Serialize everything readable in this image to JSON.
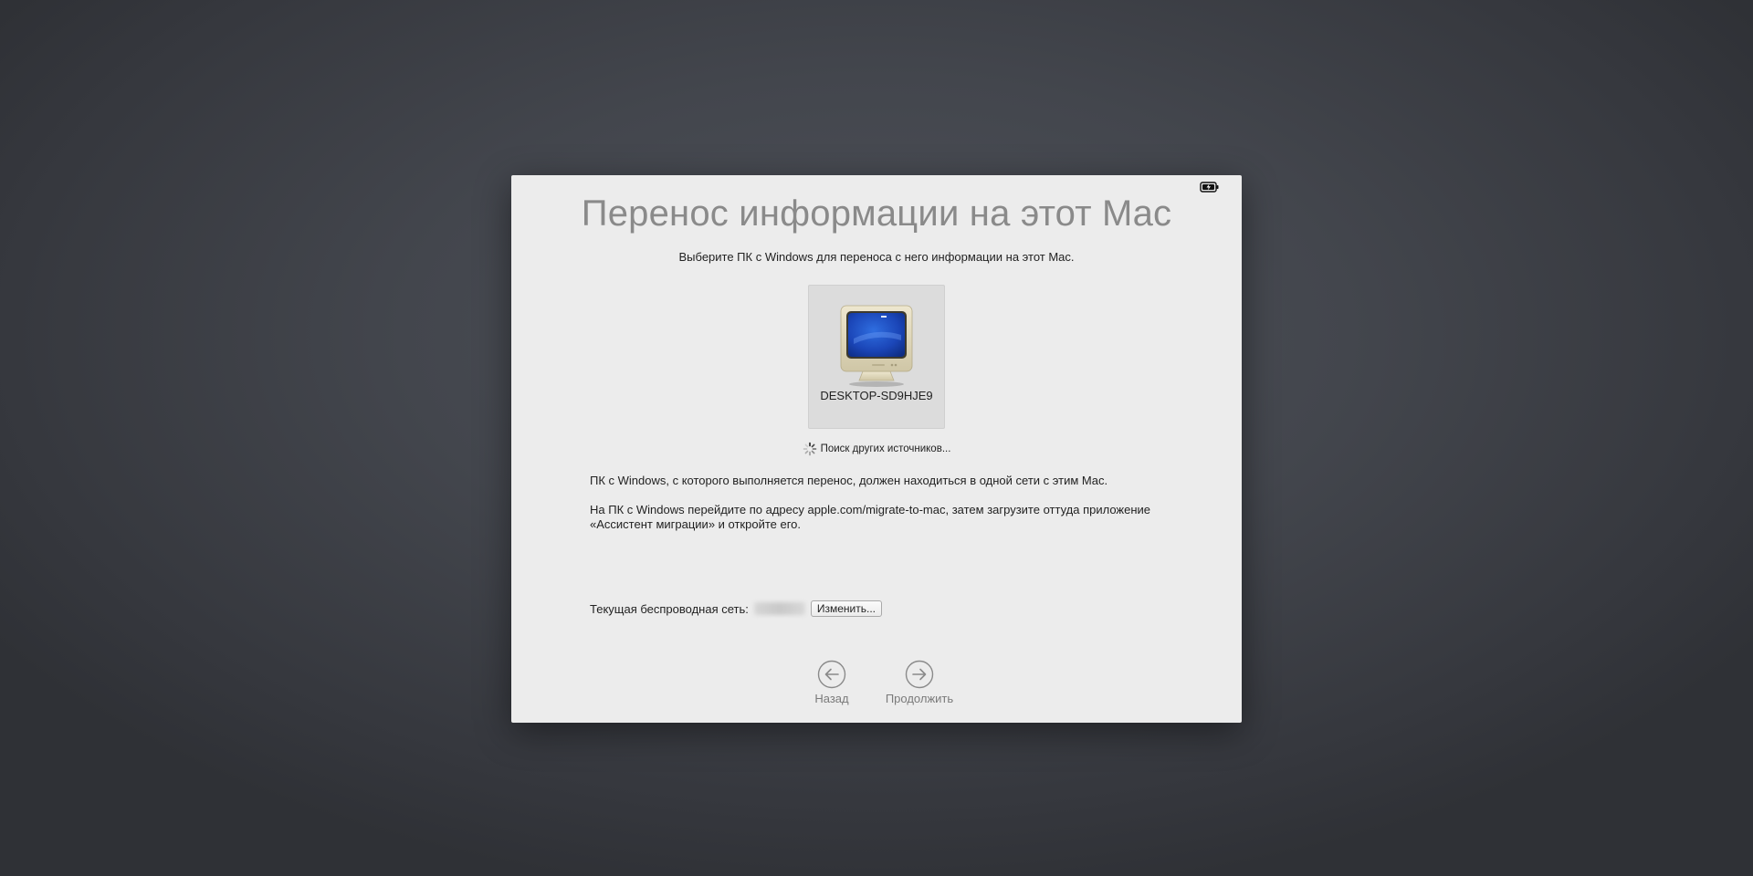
{
  "window": {
    "title": "Перенос информации на этот Mac",
    "subtitle": "Выберите ПК с Windows для переноса с него информации на этот Mac."
  },
  "source": {
    "name": "DESKTOP-SD9HJE9",
    "icon": "windows-pc-monitor-icon"
  },
  "search_status": "Поиск других источников...",
  "info": {
    "line1": "ПК с Windows, с которого выполняется перенос, должен находиться в одной сети с этим Mac.",
    "line2": "На ПК с Windows перейдите по адресу apple.com/migrate-to-mac, затем загрузите оттуда приложение «Ассистент миграции» и откройте его."
  },
  "network": {
    "label": "Текущая беспроводная сеть:",
    "change_label": "Изменить..."
  },
  "nav": {
    "back_label": "Назад",
    "continue_label": "Продолжить"
  }
}
